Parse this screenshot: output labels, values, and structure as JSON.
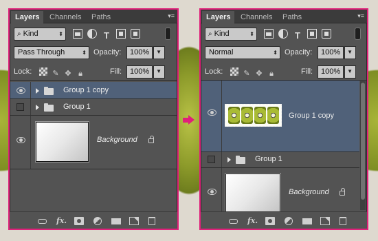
{
  "tabs": [
    "Layers",
    "Channels",
    "Paths"
  ],
  "labels": {
    "kind": "Kind",
    "opacity": "Opacity:",
    "fill": "Fill:",
    "lock": "Lock:",
    "opacity_value": "100%",
    "fill_value": "100%"
  },
  "colors": {
    "highlight_border": "#e0207a",
    "selected_row": "#506179",
    "panel_bg": "#535353"
  },
  "left_panel": {
    "blend_mode": "Pass Through",
    "layers": [
      {
        "name": "Group 1 copy",
        "type": "group",
        "visible": true,
        "selected": true
      },
      {
        "name": "Group 1",
        "type": "group",
        "visible": false,
        "selected": false
      },
      {
        "name": "Background",
        "type": "background",
        "visible": true,
        "locked": true
      }
    ]
  },
  "right_panel": {
    "blend_mode": "Normal",
    "layers": [
      {
        "name": "Group 1 copy",
        "type": "merged-text-layer",
        "visible": true,
        "selected": true
      },
      {
        "name": "Group 1",
        "type": "group",
        "visible": false,
        "selected": false
      },
      {
        "name": "Background",
        "type": "background",
        "visible": true,
        "locked": true
      }
    ]
  },
  "filter_icons": [
    "pixel-layer-filter-icon",
    "adjustment-filter-icon",
    "type-filter-icon",
    "shape-filter-icon",
    "smart-object-filter-icon"
  ],
  "lock_icons": [
    "lock-transparent-icon",
    "lock-image-icon",
    "lock-position-icon",
    "lock-all-icon"
  ],
  "bottom_icons": [
    "link-layers-icon",
    "fx-icon",
    "layer-mask-icon",
    "adjustment-layer-icon",
    "group-folder-icon",
    "new-layer-icon",
    "trash-icon"
  ]
}
